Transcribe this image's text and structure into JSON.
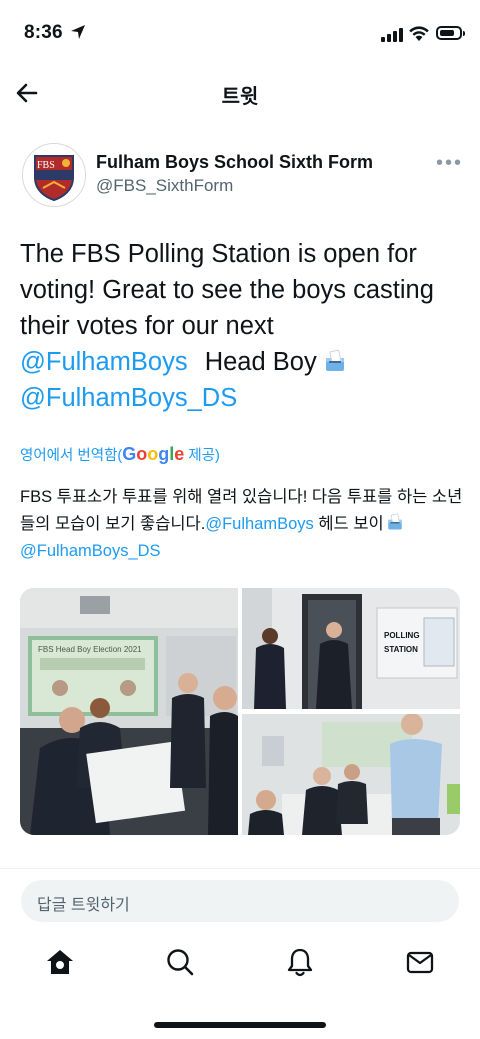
{
  "status_bar": {
    "time": "8:36"
  },
  "nav": {
    "title": "트윗"
  },
  "account": {
    "name": "Fulham Boys School Sixth Form",
    "handle": "@FBS_SixthForm",
    "logo_text": "FBS"
  },
  "tweet": {
    "line1": "The FBS Polling Station is open for voting! Great to see the boys casting their votes for our next",
    "mention1": "@FulhamBoys",
    "text_head_boy": "Head Boy",
    "mention2": "@FulhamBoys_DS",
    "emoji": "ballot-box-icon"
  },
  "translation": {
    "note_prefix": "영어에서 번역함(",
    "provider": "Google",
    "note_suffix": " 제공)",
    "text": "FBS 투표소가 투표를 위해 열려 있습니다! 다음 투표를 하는 소년들의 모습이 보기 좋습니다.",
    "mention1": "@FulhamBoys",
    "middle": "헤드 보이",
    "mention2": "@FulhamBoys_DS"
  },
  "media": {
    "slide_title": "FBS Head Boy Election 2021",
    "slide_text": "Vote for one candidate by putting a cross in the box next to your choice",
    "sign_line1": "POLLING",
    "sign_line2": "STATION"
  },
  "reply": {
    "placeholder": "답글 트윗하기"
  },
  "tabs": [
    "home-icon",
    "search-icon",
    "notifications-icon",
    "messages-icon"
  ],
  "colors": {
    "accent": "#1d9bf0",
    "text": "#0f1419",
    "muted": "#536471"
  }
}
